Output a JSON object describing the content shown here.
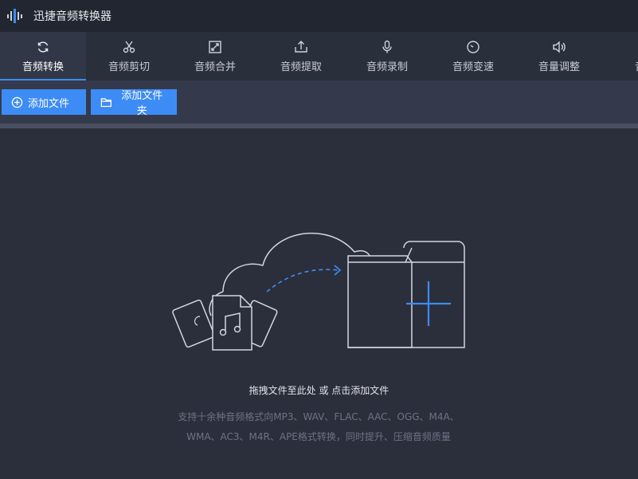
{
  "app": {
    "title": "迅捷音频转换器",
    "logo_icon": "sound-wave-icon"
  },
  "toolbar": {
    "items": [
      {
        "label": "音频转换",
        "icon": "refresh-icon",
        "active": true
      },
      {
        "label": "音频剪切",
        "icon": "scissors-icon",
        "active": false
      },
      {
        "label": "音频合并",
        "icon": "merge-icon",
        "active": false
      },
      {
        "label": "音频提取",
        "icon": "extract-icon",
        "active": false
      },
      {
        "label": "音频录制",
        "icon": "microphone-icon",
        "active": false
      },
      {
        "label": "音频变速",
        "icon": "speed-icon",
        "active": false
      },
      {
        "label": "音量调整",
        "icon": "volume-icon",
        "active": false
      },
      {
        "label": "音频",
        "icon": "sound-wave-icon",
        "active": false
      }
    ]
  },
  "actions": {
    "add_file": "添加文件",
    "add_folder": "添加文件夹"
  },
  "dropzone": {
    "hint": "拖拽文件至此处 或 点击添加文件",
    "support_line1": "支持十余种音频格式向MP3、WAV、FLAC、AAC、OGG、M4A、",
    "support_line2": "WMA、AC3、M4R、APE格式转换，同时提升、压缩音频质量"
  },
  "colors": {
    "accent": "#3d8cf5",
    "background": "#2b2f3b",
    "titlebar": "#222630",
    "toolbar": "#2a2f3c",
    "actionbar": "#343a4c"
  }
}
